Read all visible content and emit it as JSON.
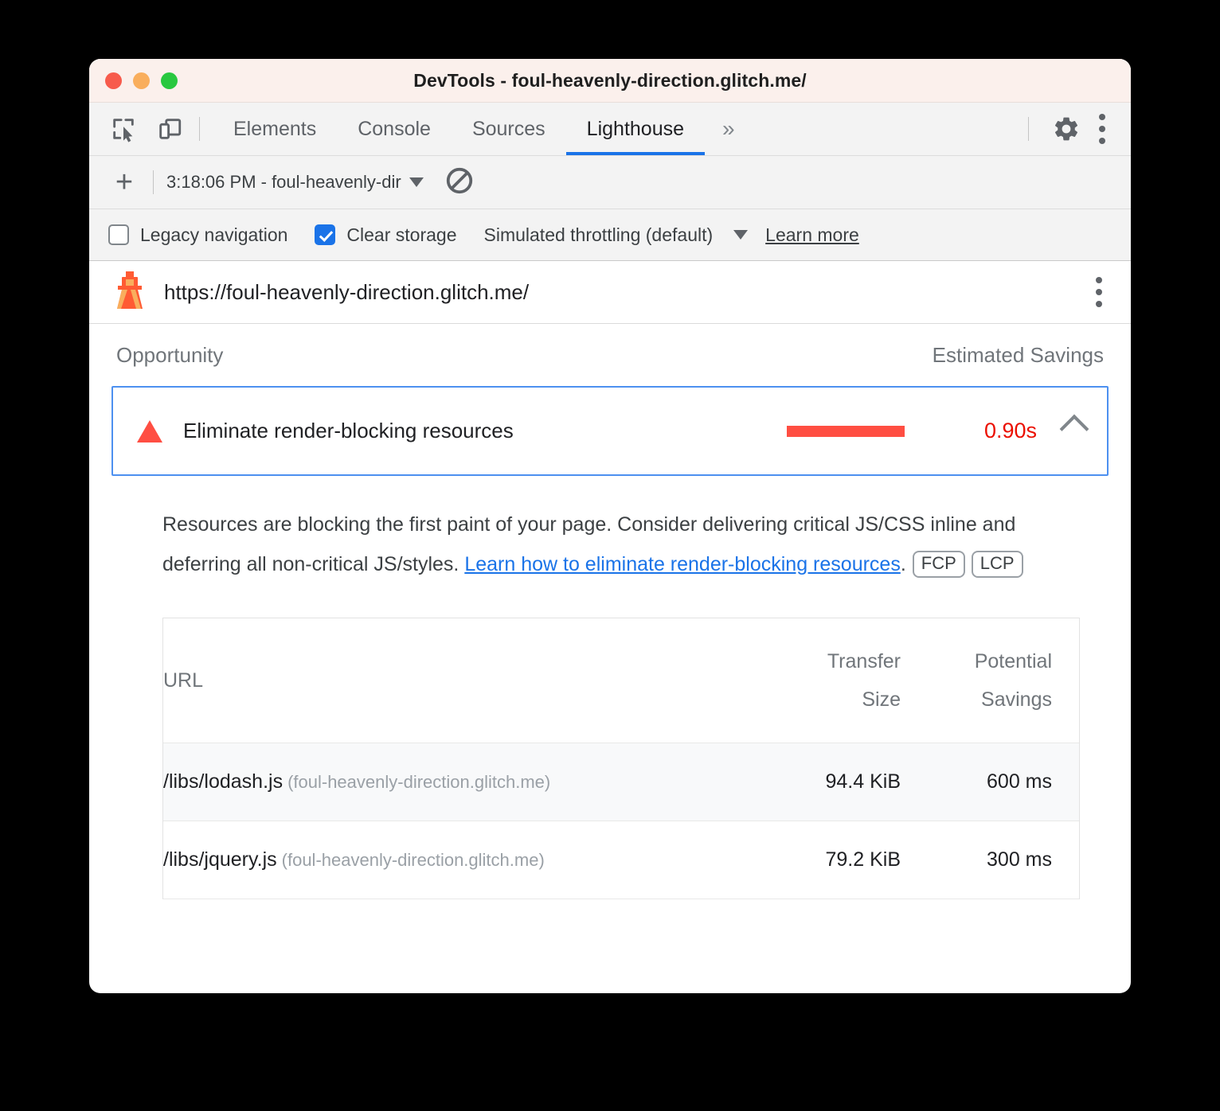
{
  "window": {
    "title": "DevTools - foul-heavenly-direction.glitch.me/",
    "traffic_lights": [
      "close",
      "minimize",
      "zoom"
    ]
  },
  "tabbar": {
    "icons": [
      "inspect-element-icon",
      "device-toolbar-icon"
    ],
    "tabs": [
      {
        "label": "Elements",
        "active": false
      },
      {
        "label": "Console",
        "active": false
      },
      {
        "label": "Sources",
        "active": false
      },
      {
        "label": "Lighthouse",
        "active": true
      }
    ],
    "overflow": "»",
    "right_icons": [
      "gear-icon",
      "more-vertical-icon"
    ]
  },
  "runbar": {
    "add_label": "+",
    "run_selected": "3:18:06 PM - foul-heavenly-dir",
    "clear_icon": "clear-all-icon"
  },
  "settings": {
    "legacy_navigation": {
      "label": "Legacy navigation",
      "checked": false
    },
    "clear_storage": {
      "label": "Clear storage",
      "checked": true
    },
    "throttling": "Simulated throttling (default)",
    "learn_more": "Learn more"
  },
  "report": {
    "url": "https://foul-heavenly-direction.glitch.me/",
    "lighthouse_icon": "lighthouse-icon",
    "menu_icon": "more-vertical-icon",
    "columns": {
      "opportunity": "Opportunity",
      "estimated_savings": "Estimated Savings"
    },
    "opportunity": {
      "severity_icon": "warning-triangle-icon",
      "title": "Eliminate render-blocking resources",
      "savings": "0.90s",
      "expanded": true,
      "toggle_icon": "chevron-up-icon",
      "description_part1": "Resources are blocking the first paint of your page. Consider delivering critical JS/CSS inline and deferring all non-critical JS/styles. ",
      "description_link": "Learn how to eliminate render-blocking resources",
      "description_part2": ".",
      "metric_badges": [
        "FCP",
        "LCP"
      ]
    },
    "table": {
      "headers": {
        "url": "URL",
        "transfer_size_line1": "Transfer",
        "transfer_size_line2": "Size",
        "potential_savings_line1": "Potential",
        "potential_savings_line2": "Savings"
      },
      "rows": [
        {
          "path": "/libs/lodash.js",
          "host": "(foul-heavenly-direction.glitch.me)",
          "transfer_size": "94.4 KiB",
          "potential_savings": "600 ms"
        },
        {
          "path": "/libs/jquery.js",
          "host": "(foul-heavenly-direction.glitch.me)",
          "transfer_size": "79.2 KiB",
          "potential_savings": "300 ms"
        }
      ]
    }
  },
  "colors": {
    "accent_blue": "#1a73e8",
    "severity_red": "#ff4e42",
    "savings_red": "#eb0f00",
    "titlebar_bg": "#fbf0ec",
    "focus_outline": "#4d90f0"
  }
}
